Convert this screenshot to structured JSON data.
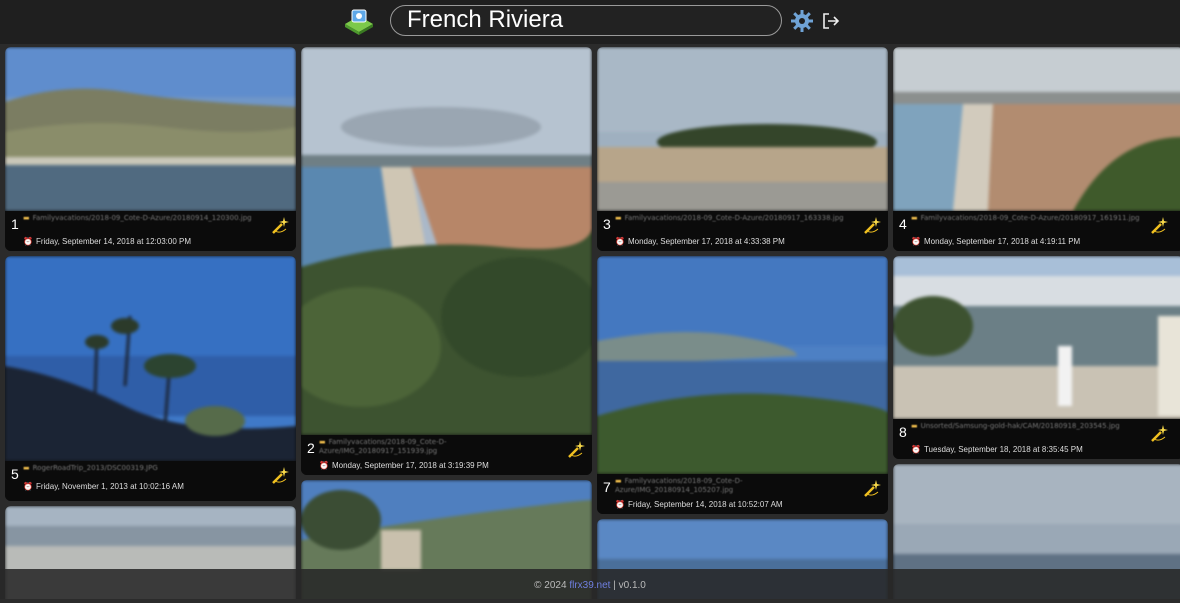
{
  "header": {
    "title": "French Riviera"
  },
  "icons": {
    "logo": "photo-album-icon",
    "settings": "gear-icon",
    "logout": "logout-icon",
    "folder": "folder-icon",
    "clock": "alarm-clock-icon",
    "magic": "magic-wand-icon"
  },
  "photos": [
    {
      "num": "1",
      "path": "Familyvacations/2018-09_Cote-D-Azure/20180914_120300.jpg",
      "date": "Friday, September 14, 2018 at 12:03:00 PM"
    },
    {
      "num": "2",
      "path": "Familyvacations/2018-09_Cote-D-Azure/IMG_20180917_151939.jpg",
      "date": "Monday, September 17, 2018 at 3:19:39 PM"
    },
    {
      "num": "3",
      "path": "Familyvacations/2018-09_Cote-D-Azure/20180917_163338.jpg",
      "date": "Monday, September 17, 2018 at 4:33:38 PM"
    },
    {
      "num": "4",
      "path": "Familyvacations/2018-09_Cote-D-Azure/20180917_161911.jpg",
      "date": "Monday, September 17, 2018 at 4:19:11 PM"
    },
    {
      "num": "5",
      "path": "RogerRoadTrip_2013/DSC00319.JPG",
      "date": "Friday, November 1, 2013 at 10:02:16 AM"
    },
    {
      "num": "7",
      "path": "Familyvacations/2018-09_Cote-D-Azure/IMG_20180914_105207.jpg",
      "date": "Friday, September 14, 2018 at 10:52:07 AM"
    },
    {
      "num": "8",
      "path": "Unsorted/Samsung-gold-hak/CAM/20180918_203545.jpg",
      "date": "Tuesday, September 18, 2018 at 8:35:45 PM"
    }
  ],
  "footer": {
    "copyright": "© 2024",
    "site": "flrx39.net",
    "separator": "|",
    "version": "v0.1.0"
  }
}
